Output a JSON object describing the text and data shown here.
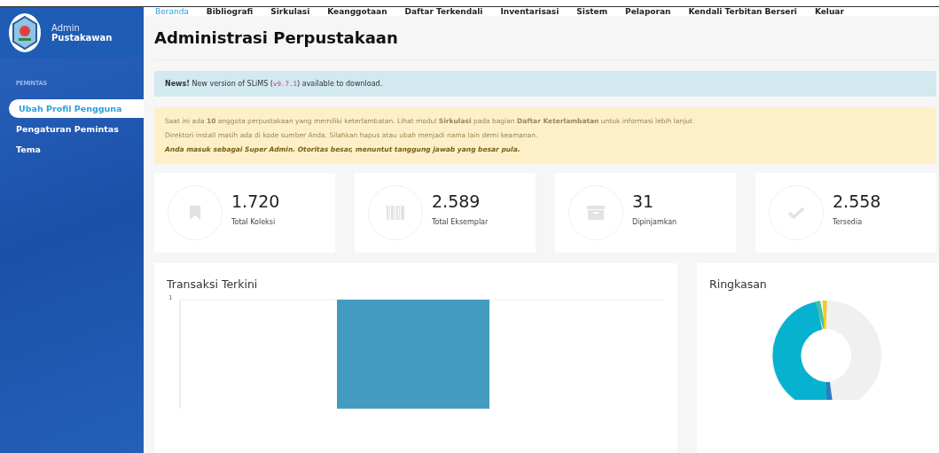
{
  "user": {
    "role": "Admin",
    "name": "Pustakawan"
  },
  "nav": [
    {
      "label": "Beranda",
      "selected": true
    },
    {
      "label": "Bibliografi",
      "selected": false
    },
    {
      "label": "Sirkulasi",
      "selected": false
    },
    {
      "label": "Keanggotaan",
      "selected": false
    },
    {
      "label": "Daftar Terkendali",
      "selected": false
    },
    {
      "label": "Inventarisasi",
      "selected": false
    },
    {
      "label": "Sistem",
      "selected": false
    },
    {
      "label": "Pelaporan",
      "selected": false
    },
    {
      "label": "Kendali Terbitan Berseri",
      "selected": false
    },
    {
      "label": "Keluar",
      "selected": false
    }
  ],
  "sidebar": {
    "heading": "PEMINTAS",
    "items": [
      {
        "label": "Ubah Profil Pengguna",
        "selected": true
      },
      {
        "label": "Pengaturan Pemintas",
        "selected": false
      },
      {
        "label": "Tema",
        "selected": false
      }
    ]
  },
  "page_title": "Administrasi Perpustakaan",
  "news": {
    "text": "**News!** New version of SLiMS (",
    "version": "v9.7.1",
    "suffix": ") available to download."
  },
  "warning": {
    "lines": [
      "Saat ini ada **10** anggota perpustakaan yang memiliki keterlambatan. Lihat modul **Sirkulasi** pada bagian **Daftar Keterlambatan** untuk informasi lebih lanjut",
      "Direktori install masih ada di kode sumber Anda. Silahkan hapus atau ubah menjadi nama lain demi keamanan.",
      "Anda masuk sebagai Super Admin. Otoritas besar, menuntut tanggung jawab yang besar pula."
    ]
  },
  "stats": [
    {
      "kind": "bookmark",
      "value": "1.720",
      "label": "Total Koleksi"
    },
    {
      "kind": "barcode",
      "value": "2.589",
      "label": "Total Eksemplar"
    },
    {
      "kind": "archive",
      "value": "31",
      "label": "Dipinjamkan"
    },
    {
      "kind": "check",
      "value": "2.558",
      "label": "Tersedia"
    }
  ],
  "transactions": {
    "title": "Transaksi Terkini",
    "y_tick_label": "1"
  },
  "summary": {
    "title": "Ringkasan"
  }
}
